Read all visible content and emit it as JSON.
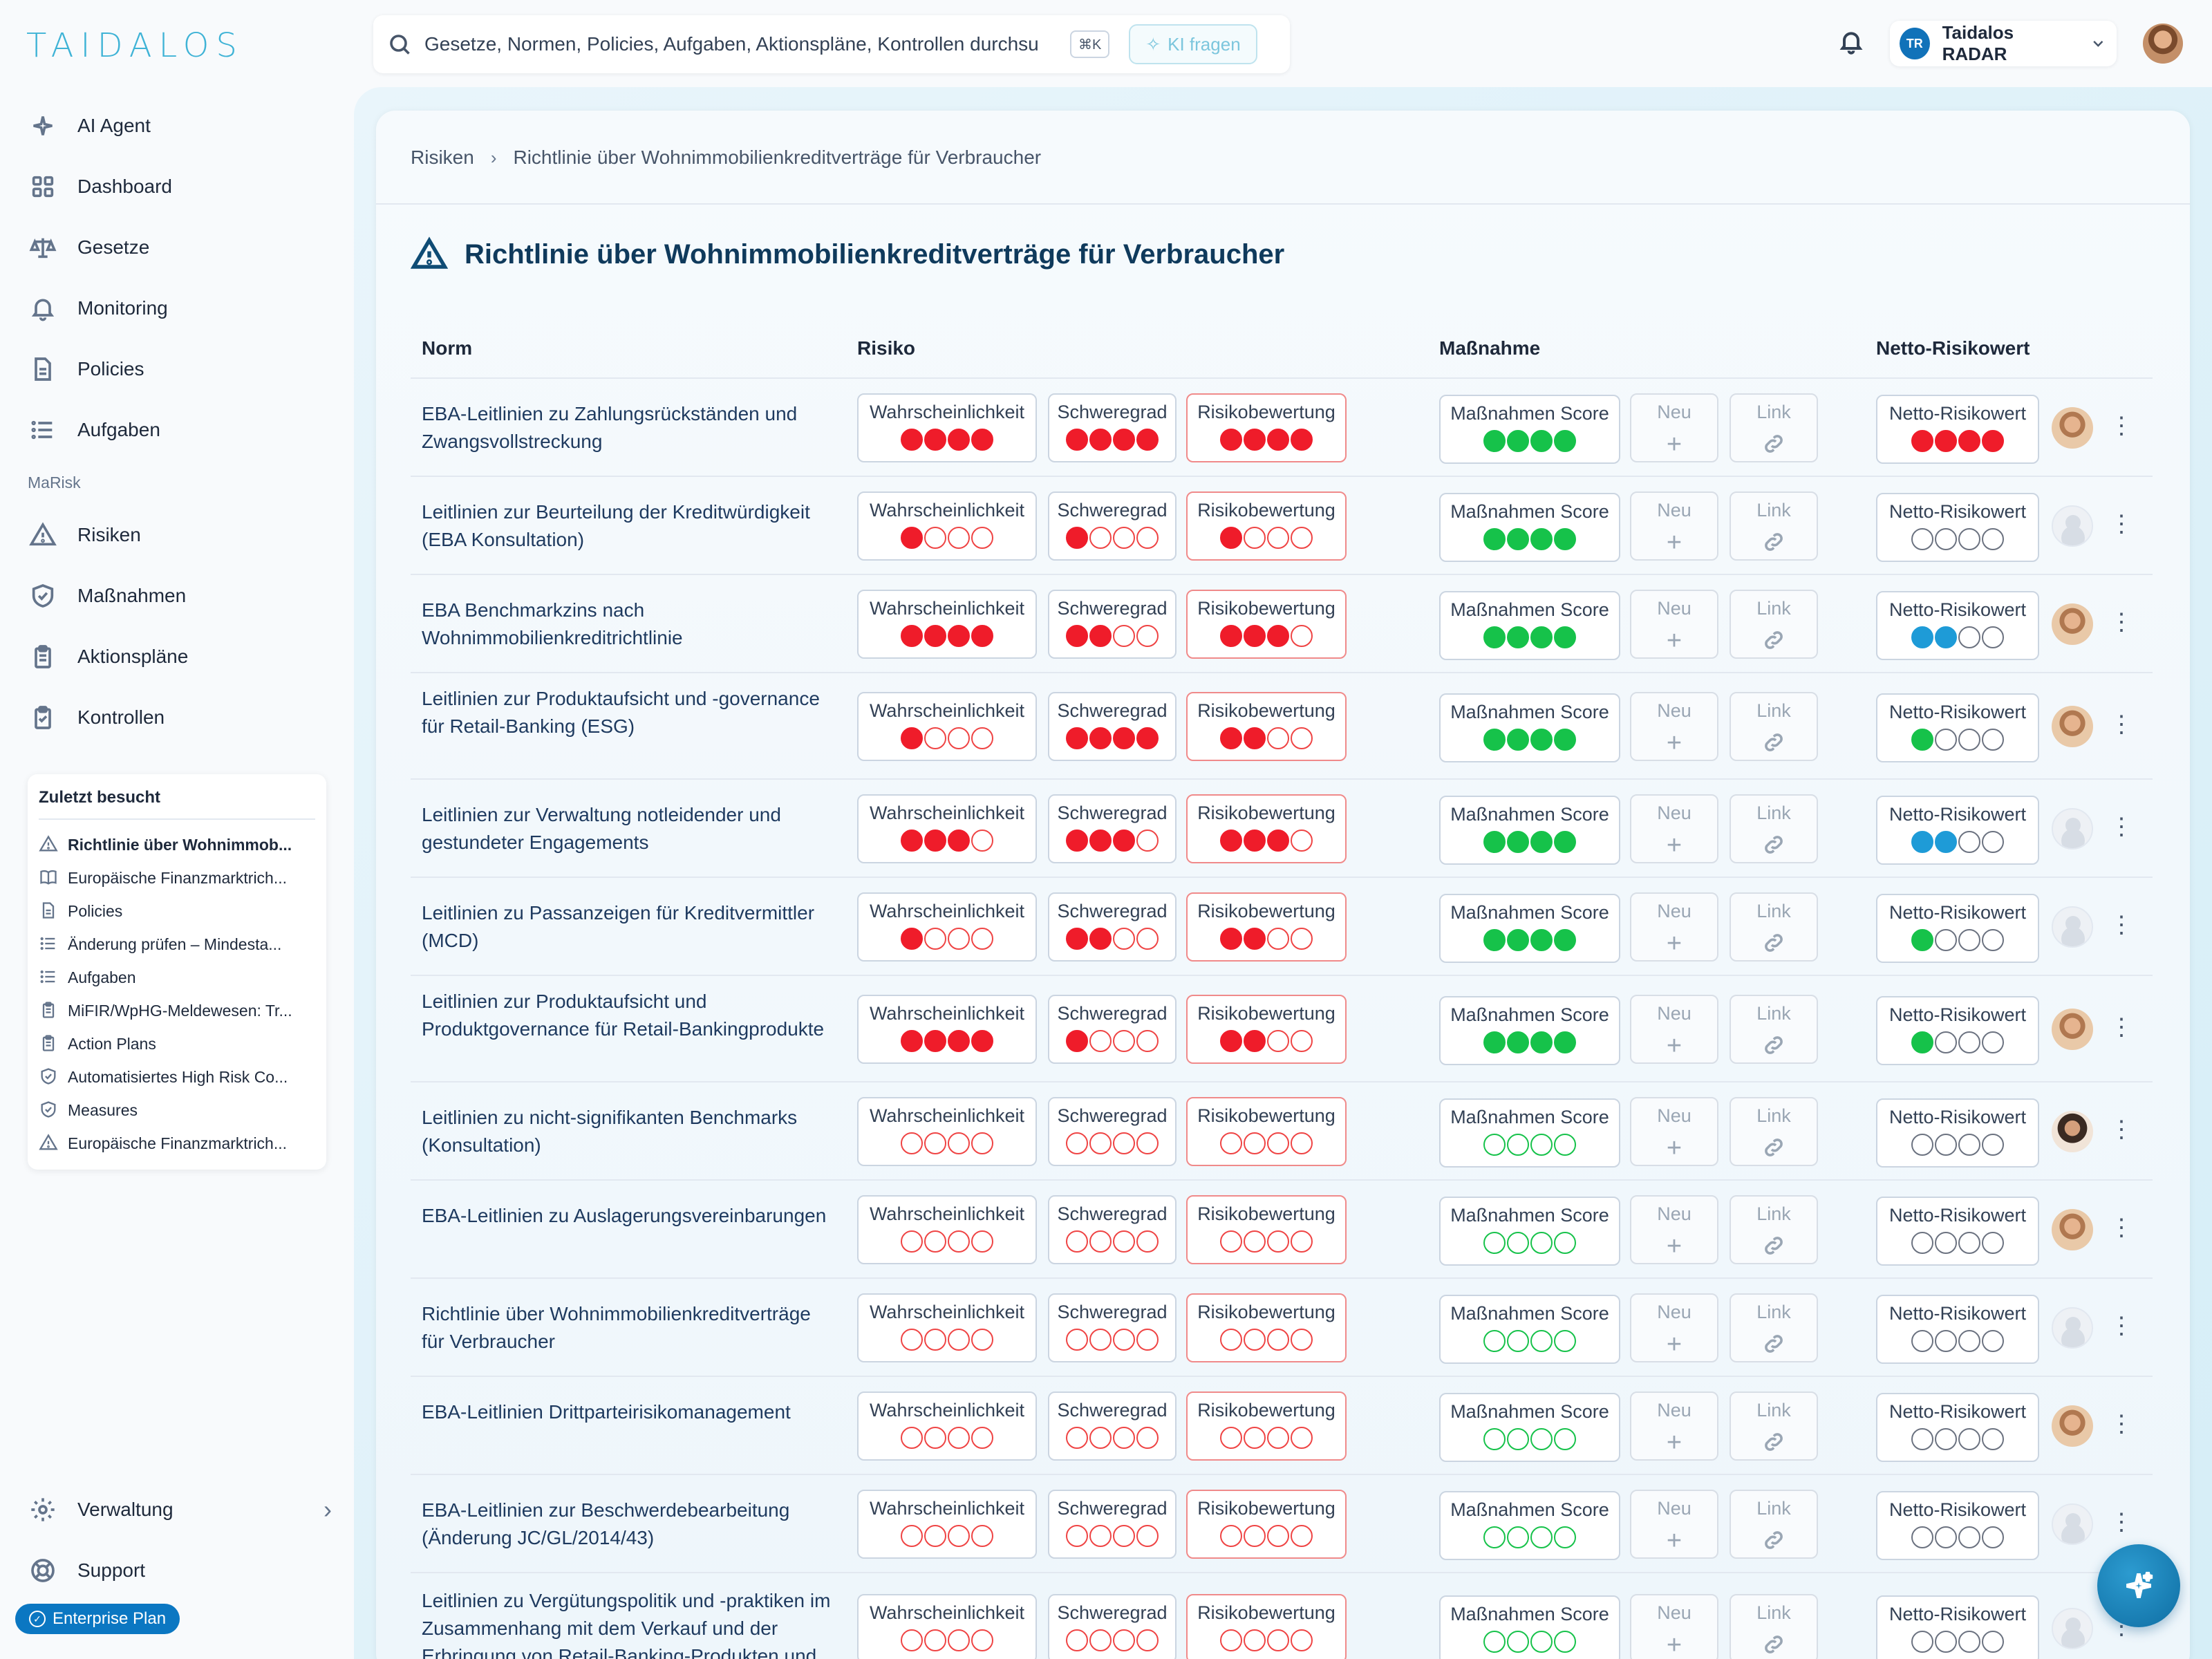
{
  "app": {
    "logo_text": "TAIDALOS",
    "brand_color": "#3fb3d6",
    "accent_color": "#0b77c2"
  },
  "sidebar": {
    "nav": [
      {
        "label": "AI Agent",
        "icon": "sparkles-icon"
      },
      {
        "label": "Dashboard",
        "icon": "grid-icon"
      },
      {
        "label": "Gesetze",
        "icon": "scale-icon"
      },
      {
        "label": "Monitoring",
        "icon": "bell-icon"
      },
      {
        "label": "Policies",
        "icon": "document-icon"
      },
      {
        "label": "Aufgaben",
        "icon": "list-icon"
      }
    ],
    "section_label": "MaRisk",
    "marisk": [
      {
        "label": "Risiken",
        "icon": "warning-icon"
      },
      {
        "label": "Maßnahmen",
        "icon": "shield-check-icon"
      },
      {
        "label": "Aktionspläne",
        "icon": "clipboard-list-icon"
      },
      {
        "label": "Kontrollen",
        "icon": "clipboard-check-icon"
      }
    ],
    "recent_title": "Zuletzt besucht",
    "recent": [
      {
        "label": "Richtlinie über Wohnimmob...",
        "icon": "warning-icon",
        "active": true
      },
      {
        "label": "Europäische Finanzmarktrich...",
        "icon": "book-icon"
      },
      {
        "label": "Policies",
        "icon": "document-icon"
      },
      {
        "label": "Änderung prüfen – Mindesta...",
        "icon": "list-icon"
      },
      {
        "label": "Aufgaben",
        "icon": "list-icon"
      },
      {
        "label": "MiFIR/WpHG-Meldewesen: Tr...",
        "icon": "clipboard-list-icon"
      },
      {
        "label": "Action Plans",
        "icon": "clipboard-list-icon"
      },
      {
        "label": "Automatisiertes High Risk Co...",
        "icon": "shield-check-icon"
      },
      {
        "label": "Measures",
        "icon": "shield-check-icon"
      },
      {
        "label": "Europäische Finanzmarktrich...",
        "icon": "warning-icon"
      }
    ],
    "bottom": [
      {
        "label": "Verwaltung",
        "icon": "gear-icon"
      },
      {
        "label": "Support",
        "icon": "lifebuoy-icon"
      }
    ],
    "plan_label": "Enterprise Plan"
  },
  "topbar": {
    "search_placeholder": "Gesetze, Normen, Policies, Aufgaben, Aktionspläne, Kontrollen durchsu",
    "shortcut": "⌘K",
    "ai_button": "KI fragen",
    "user_initials": "TR",
    "user_name": "Taidalos RADAR"
  },
  "breadcrumb": [
    "Risiken",
    "Richtlinie über Wohnimmobilienkreditverträge für Verbraucher"
  ],
  "page_title": "Richtlinie über Wohnimmobilienkreditverträge für Verbraucher",
  "table": {
    "headers": {
      "norm": "Norm",
      "risk": "Risiko",
      "measure": "Maßnahme",
      "net": "Netto-Risikowert"
    },
    "labels": {
      "likelihood": "Wahrscheinlichkeit",
      "severity": "Schweregrad",
      "assessment": "Risikobewertung",
      "measure_score": "Maßnahmen Score",
      "new": "Neu",
      "link": "Link",
      "net": "Netto-Risikowert"
    },
    "colors": {
      "risk_red": "#ef1c2a",
      "measure_green": "#16c24a",
      "net_blue": "#1e9bd7"
    },
    "rows": [
      {
        "norm": "EBA-Leitlinien zu Zahlungsrückständen und Zwangsvollstreckung",
        "likelihood": 4,
        "severity": 4,
        "assessment": 4,
        "measure": 4,
        "net": 4,
        "net_color": "red",
        "avatar": "photo"
      },
      {
        "norm": "Leitlinien zur Beurteilung der Kreditwürdigkeit (EBA Konsultation)",
        "likelihood": 1,
        "severity": 1,
        "assessment": 1,
        "measure": 4,
        "net": 0,
        "net_color": "none",
        "avatar": "blank"
      },
      {
        "norm": "EBA Benchmarkzins nach Wohnimmobilienkreditrichtlinie",
        "likelihood": 4,
        "severity": 2,
        "assessment": 3,
        "measure": 4,
        "net": 2,
        "net_color": "blue",
        "avatar": "photo"
      },
      {
        "norm": "Leitlinien zur Produktaufsicht und -governance für Retail-Banking (ESG)",
        "likelihood": 1,
        "severity": 4,
        "assessment": 2,
        "measure": 4,
        "net": 1,
        "net_color": "green",
        "avatar": "photo"
      },
      {
        "norm": "Leitlinien zur Verwaltung notleidender und gestundeter Engagements",
        "likelihood": 3,
        "severity": 3,
        "assessment": 3,
        "measure": 4,
        "net": 2,
        "net_color": "blue",
        "avatar": "blank"
      },
      {
        "norm": "Leitlinien zu Passanzeigen für Kreditvermittler (MCD)",
        "likelihood": 1,
        "severity": 2,
        "assessment": 2,
        "measure": 4,
        "net": 1,
        "net_color": "green",
        "avatar": "blank"
      },
      {
        "norm": "Leitlinien zur Produktaufsicht und Produktgovernance für Retail-Bankingprodukte",
        "likelihood": 4,
        "severity": 1,
        "assessment": 2,
        "measure": 4,
        "net": 1,
        "net_color": "green",
        "avatar": "photo"
      },
      {
        "norm": "Leitlinien zu nicht-signifikanten Benchmarks (Konsultation)",
        "likelihood": 0,
        "severity": 0,
        "assessment": 0,
        "measure": 0,
        "net": 0,
        "net_color": "none",
        "avatar": "photo2"
      },
      {
        "norm": "EBA-Leitlinien zu Auslagerungsvereinbarungen",
        "likelihood": 0,
        "severity": 0,
        "assessment": 0,
        "measure": 0,
        "net": 0,
        "net_color": "none",
        "avatar": "photo"
      },
      {
        "norm": "Richtlinie über Wohnimmobilienkreditverträge für Verbraucher",
        "likelihood": 0,
        "severity": 0,
        "assessment": 0,
        "measure": 0,
        "net": 0,
        "net_color": "none",
        "avatar": "blank"
      },
      {
        "norm": "EBA-Leitlinien Drittparteirisikomanagement",
        "likelihood": 0,
        "severity": 0,
        "assessment": 0,
        "measure": 0,
        "net": 0,
        "net_color": "none",
        "avatar": "photo"
      },
      {
        "norm": "EBA-Leitlinien zur Beschwerdebearbeitung (Änderung JC/GL/2014/43)",
        "likelihood": 0,
        "severity": 0,
        "assessment": 0,
        "measure": 0,
        "net": 0,
        "net_color": "none",
        "avatar": "blank"
      },
      {
        "norm": "Leitlinien zu Vergütungspolitik und -praktiken im Zusammenhang mit dem Verkauf und der Erbringung von Retail-Banking-Produkten und",
        "likelihood": 0,
        "severity": 0,
        "assessment": 0,
        "measure": 0,
        "net": 0,
        "net_color": "none",
        "avatar": "blank"
      }
    ]
  }
}
